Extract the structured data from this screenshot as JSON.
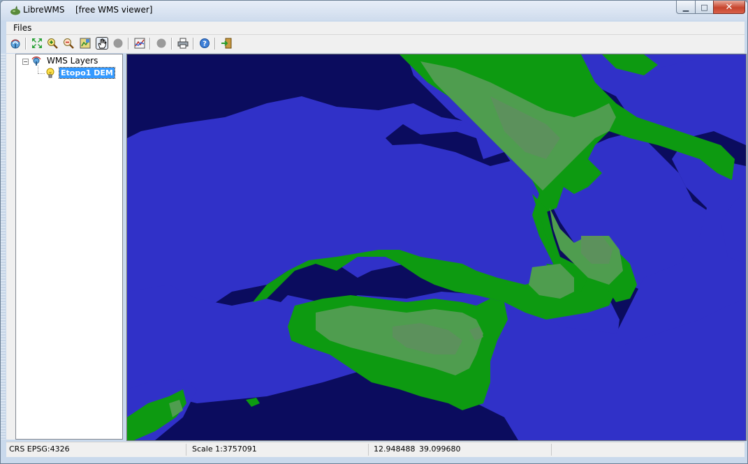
{
  "window": {
    "app_name": "LibreWMS",
    "subtitle": "[free WMS viewer]",
    "minimize_glyph": "▁",
    "maximize_glyph": "□",
    "close_glyph": "✕"
  },
  "menu": {
    "files_label": "Files"
  },
  "toolbar": {
    "buttons": [
      {
        "icon": "wms-connect-icon"
      },
      {
        "icon": "zoom-extent-icon"
      },
      {
        "icon": "zoom-in-icon"
      },
      {
        "icon": "zoom-out-icon"
      },
      {
        "icon": "zoom-layer-icon"
      },
      {
        "icon": "pan-hand-icon",
        "active": true
      },
      {
        "icon": "stop-gray-icon"
      },
      {
        "icon": "layer-info-icon"
      },
      {
        "icon": "stop-gray-icon"
      },
      {
        "icon": "print-icon"
      },
      {
        "icon": "help-icon"
      },
      {
        "icon": "exit-icon"
      }
    ]
  },
  "layers": {
    "root_label": "WMS Layers",
    "expander": "−",
    "items": [
      {
        "label": "Etopo1 DEM",
        "selected": true
      }
    ]
  },
  "map": {
    "colors": {
      "deep_sea": "#0b0c5e",
      "shallow_sea": "#3031c8",
      "lowland": "#0d9a11",
      "upland": "#4f9d4f",
      "highland": "#5c915c"
    }
  },
  "status": {
    "crs": "CRS EPSG:4326",
    "scale": "Scale 1:3757091",
    "lon": "12.948488",
    "lat": "39.099680"
  }
}
